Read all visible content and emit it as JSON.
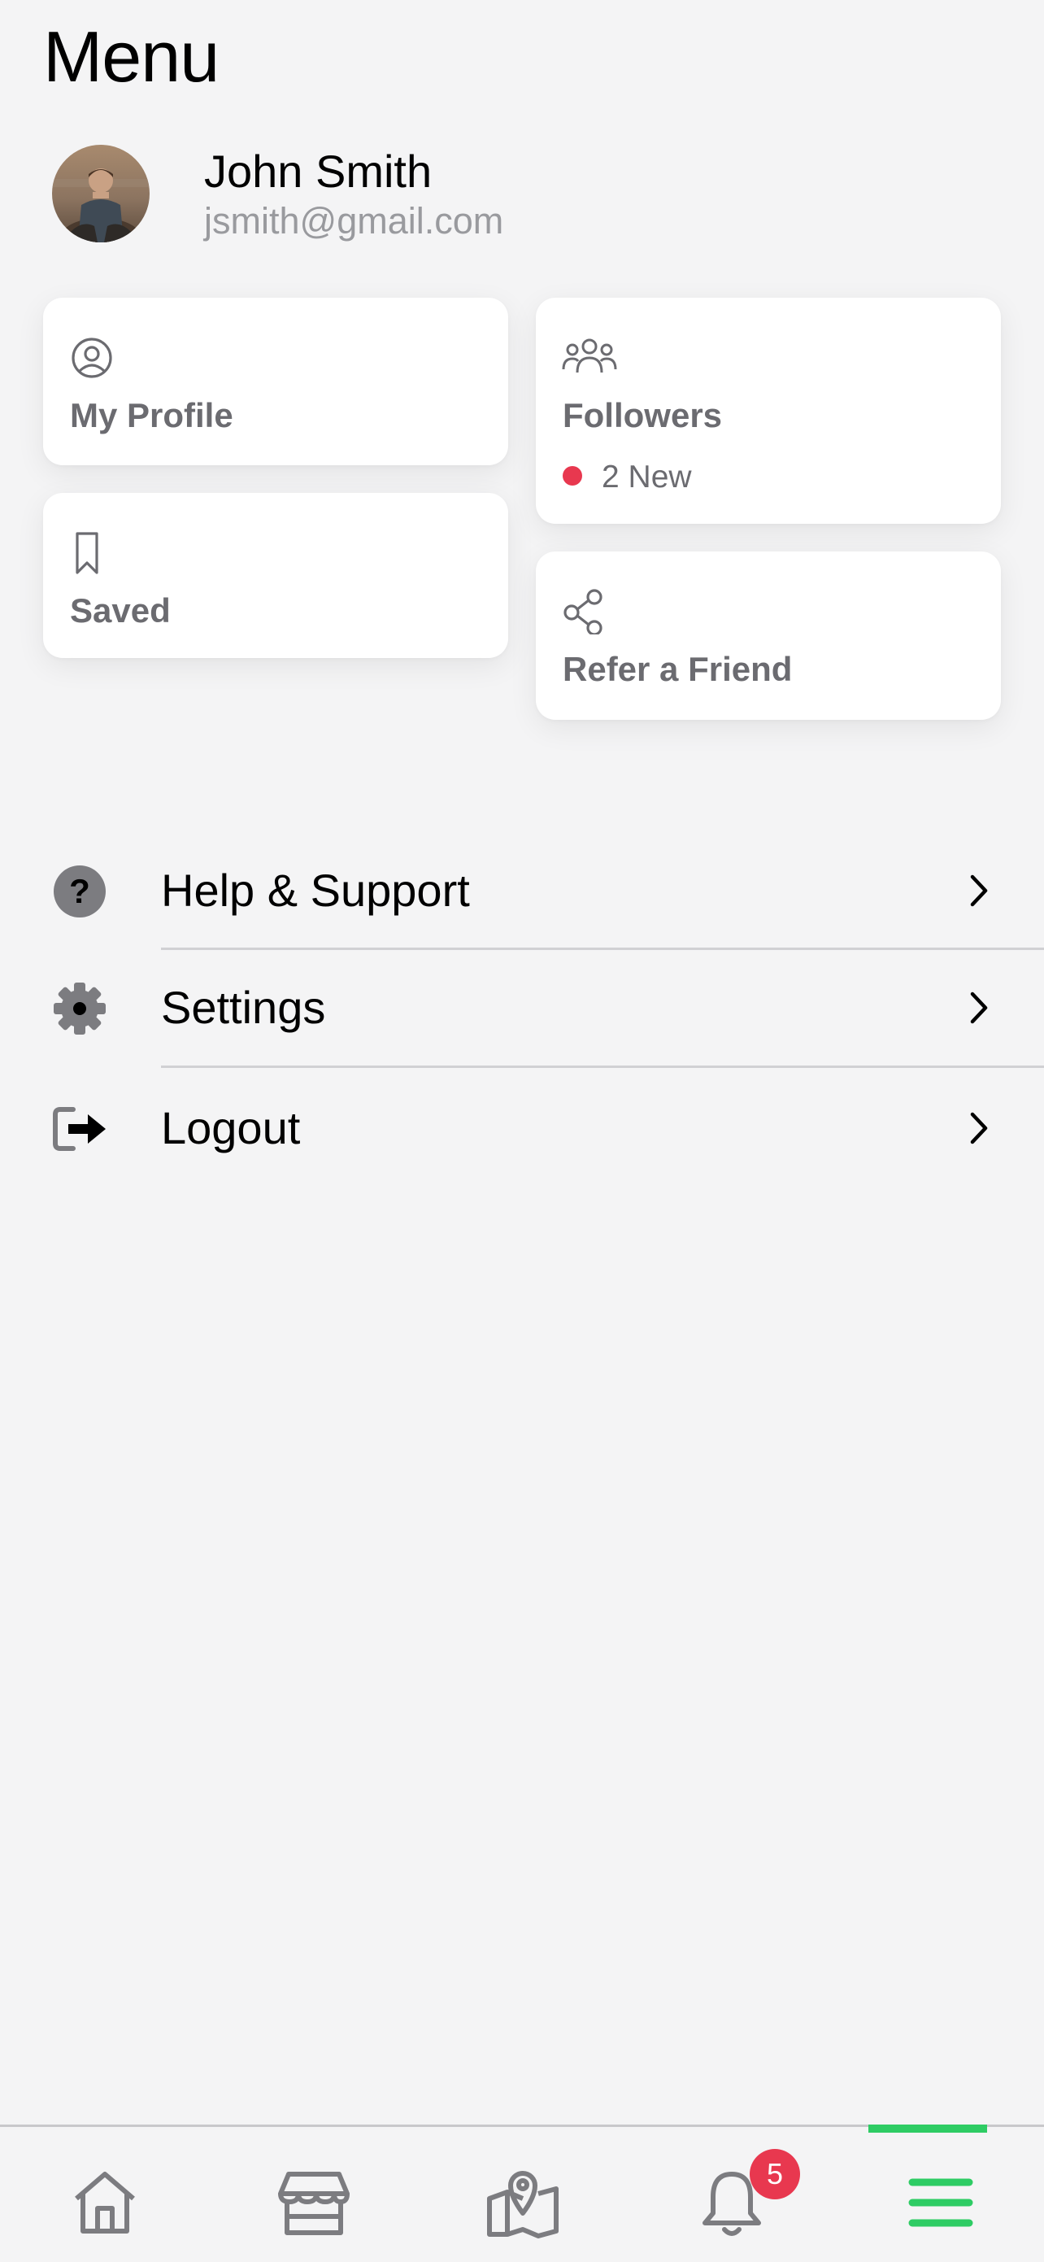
{
  "header": {
    "title": "Menu"
  },
  "user": {
    "name": "John Smith",
    "email": "jsmith@gmail.com",
    "avatar_icon": "user-photo-avatar"
  },
  "cards": {
    "profile": {
      "label": "My Profile",
      "icon": "user-circle-icon"
    },
    "followers": {
      "label": "Followers",
      "icon": "users-group-icon",
      "new_count_text": "2 New"
    },
    "saved": {
      "label": "Saved",
      "icon": "bookmark-icon"
    },
    "refer": {
      "label": "Refer a Friend",
      "icon": "share-icon"
    }
  },
  "menu": {
    "items": [
      {
        "label": "Help & Support",
        "icon": "question-circle-icon"
      },
      {
        "label": "Settings",
        "icon": "gear-icon"
      },
      {
        "label": "Logout",
        "icon": "logout-icon"
      }
    ]
  },
  "tabbar": {
    "tabs": [
      {
        "name": "home",
        "icon": "home-icon"
      },
      {
        "name": "store",
        "icon": "store-icon"
      },
      {
        "name": "map",
        "icon": "map-pin-icon"
      },
      {
        "name": "notifications",
        "icon": "bell-icon",
        "badge": "5"
      },
      {
        "name": "menu",
        "icon": "hamburger-menu-icon",
        "active": true
      }
    ]
  },
  "colors": {
    "background": "#f4f4f5",
    "card": "#ffffff",
    "accent_green": "#2ecc64",
    "notification_red": "#e8384f",
    "muted_text": "#6b6b70",
    "email_gray": "#999a9e",
    "icon_gray": "#7c7c80"
  }
}
